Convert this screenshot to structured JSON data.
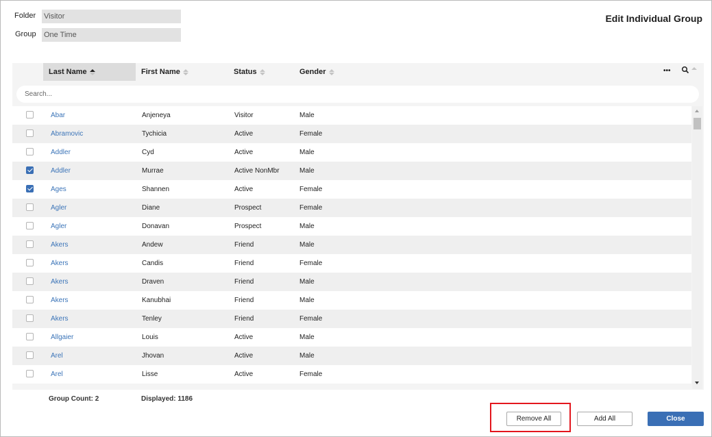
{
  "dialog": {
    "title": "Edit Individual Group"
  },
  "fields": {
    "folder_label": "Folder",
    "folder_value": "Visitor",
    "group_label": "Group",
    "group_value": "One Time"
  },
  "grid": {
    "columns": [
      "Last Name",
      "First Name",
      "Status",
      "Gender"
    ],
    "search_placeholder": "Search...",
    "more_label": "•••",
    "rows": [
      {
        "last": "Abar",
        "first": "Anjeneya",
        "status": "Visitor",
        "gender": "Male",
        "checked": false
      },
      {
        "last": "Abramovic",
        "first": "Tychicia",
        "status": "Active",
        "gender": "Female",
        "checked": false
      },
      {
        "last": "Addler",
        "first": "Cyd",
        "status": "Active",
        "gender": "Male",
        "checked": false
      },
      {
        "last": "Addler",
        "first": "Murrae",
        "status": "Active NonMbr",
        "gender": "Male",
        "checked": true
      },
      {
        "last": "Ages",
        "first": "Shannen",
        "status": "Active",
        "gender": "Female",
        "checked": true
      },
      {
        "last": "Agler",
        "first": "Diane",
        "status": "Prospect",
        "gender": "Female",
        "checked": false
      },
      {
        "last": "Agler",
        "first": "Donavan",
        "status": "Prospect",
        "gender": "Male",
        "checked": false
      },
      {
        "last": "Akers",
        "first": "Andew",
        "status": "Friend",
        "gender": "Male",
        "checked": false
      },
      {
        "last": "Akers",
        "first": "Candis",
        "status": "Friend",
        "gender": "Female",
        "checked": false
      },
      {
        "last": "Akers",
        "first": "Draven",
        "status": "Friend",
        "gender": "Male",
        "checked": false
      },
      {
        "last": "Akers",
        "first": "Kanubhai",
        "status": "Friend",
        "gender": "Male",
        "checked": false
      },
      {
        "last": "Akers",
        "first": "Tenley",
        "status": "Friend",
        "gender": "Female",
        "checked": false
      },
      {
        "last": "Allgaier",
        "first": "Louis",
        "status": "Active",
        "gender": "Male",
        "checked": false
      },
      {
        "last": "Arel",
        "first": "Jhovan",
        "status": "Active",
        "gender": "Male",
        "checked": false
      },
      {
        "last": "Arel",
        "first": "Lisse",
        "status": "Active",
        "gender": "Female",
        "checked": false
      }
    ]
  },
  "footer": {
    "group_count": "Group Count: 2",
    "displayed": "Displayed: 1186"
  },
  "buttons": {
    "remove_all": "Remove All",
    "add_all": "Add All",
    "close": "Close"
  },
  "colors": {
    "accent": "#3a6fb5",
    "link": "#3b74b8",
    "highlight": "#e3161d"
  }
}
